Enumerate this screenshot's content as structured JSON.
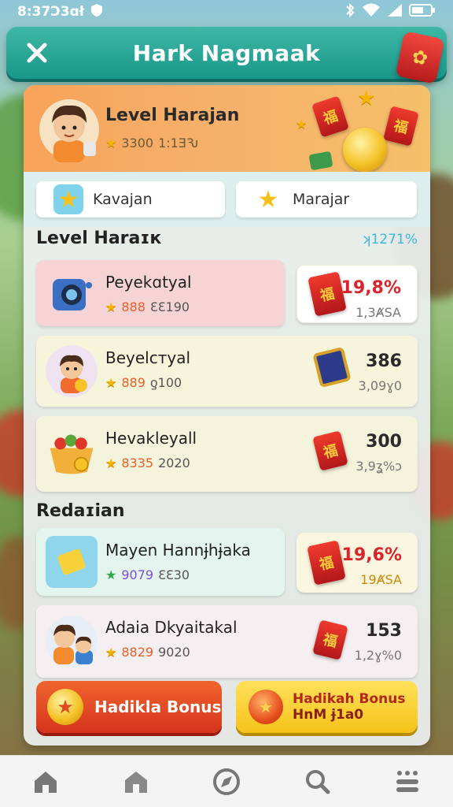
{
  "status_bar": {
    "time": "8:37Ɔ3ɑł"
  },
  "header": {
    "title": "Hark Nagmaak"
  },
  "profile": {
    "name": "Level Harajan",
    "stat_a": "3300",
    "stat_b": "1:1ƎԄ"
  },
  "tabs": [
    {
      "label": "Kavajan"
    },
    {
      "label": "Marajar"
    }
  ],
  "section1": {
    "title": "Level Haraɪк",
    "percent": "ʞ1271%"
  },
  "rows": [
    {
      "name": "Peyekɑtyal",
      "stat_a": "888",
      "stat_b": "ƐƐ190"
    },
    {
      "name": "Beyelстуal",
      "stat_a": "889",
      "stat_b": "ƍ100"
    },
    {
      "name": "Hevakleyall",
      "stat_a": "8335",
      "stat_b": "2020"
    }
  ],
  "rewards": [
    {
      "value": "19,8%",
      "sub": "1,3ȺSA"
    },
    {
      "value": "386",
      "sub": "3,09ɣ0"
    },
    {
      "value": "300",
      "sub": "3,9ʓ%ɔ"
    }
  ],
  "section2": {
    "title": "Redaɪian"
  },
  "rows2": [
    {
      "name": "Mayen Hannɉhɉaka",
      "stat_a": "9079",
      "stat_b": "ƐƐ30"
    },
    {
      "name": "Adaia Dkyaitakal",
      "stat_a": "8829",
      "stat_b": "9020"
    }
  ],
  "rewards2": [
    {
      "value": "19,6%",
      "sub": "19ȺSA"
    },
    {
      "value": "153",
      "sub": "1,2ɣ%0"
    }
  ],
  "buttons": {
    "red": "Hadikla Bonus",
    "yellow_line1": "Hadikah Bonus",
    "yellow_line2": "HnM ɉ1a0"
  },
  "colors": {
    "header": "#199789",
    "accent_red": "#d6341c",
    "accent_yellow": "#f5c219"
  }
}
